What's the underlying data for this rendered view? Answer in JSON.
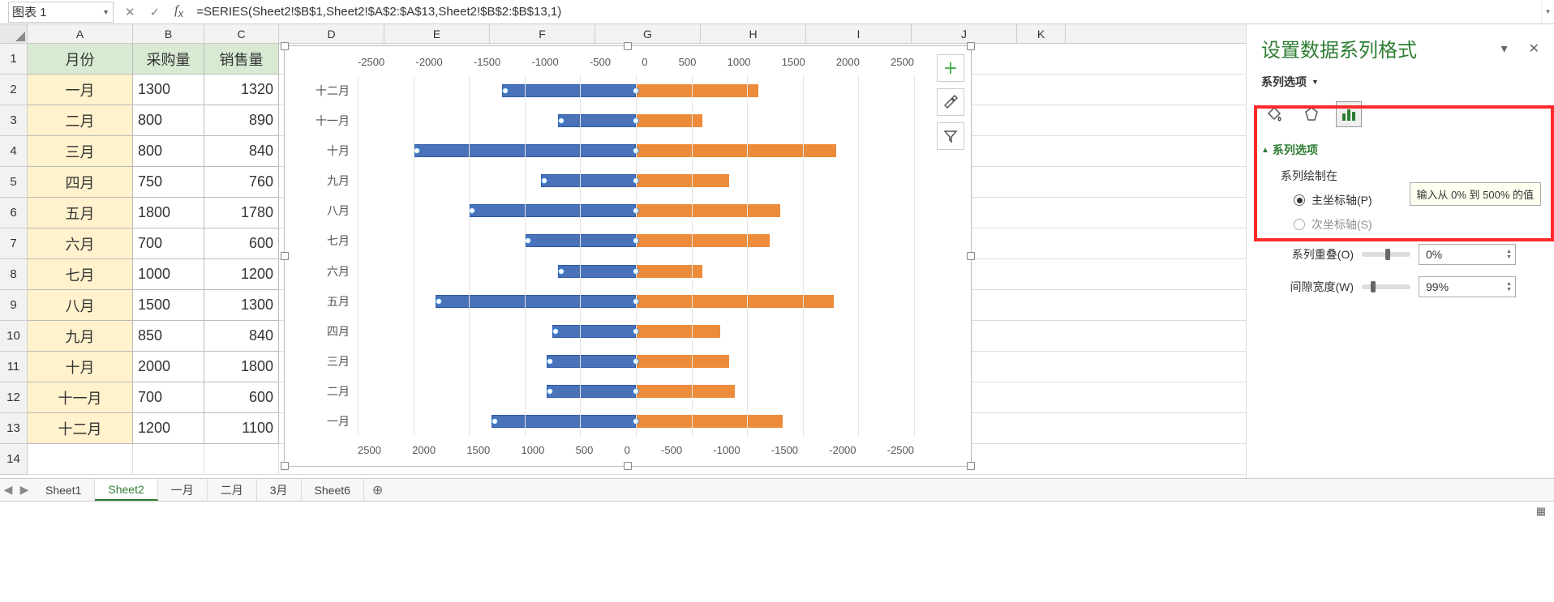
{
  "name_box": "图表 1",
  "formula": "=SERIES(Sheet2!$B$1,Sheet2!$A$2:$A$13,Sheet2!$B$2:$B$13,1)",
  "columns": [
    "A",
    "B",
    "C",
    "D",
    "E",
    "F",
    "G",
    "H",
    "I",
    "J",
    "K"
  ],
  "rows": [
    "1",
    "2",
    "3",
    "4",
    "5",
    "6",
    "7",
    "8",
    "9",
    "10",
    "11",
    "12",
    "13",
    "14"
  ],
  "data_headers": {
    "A": "月份",
    "B": "采购量",
    "C": "销售量"
  },
  "data_rows": [
    {
      "month": "一月",
      "buy": "1300",
      "sell": "1320"
    },
    {
      "month": "二月",
      "buy": "800",
      "sell": "890"
    },
    {
      "month": "三月",
      "buy": "800",
      "sell": "840"
    },
    {
      "month": "四月",
      "buy": "750",
      "sell": "760"
    },
    {
      "month": "五月",
      "buy": "1800",
      "sell": "1780"
    },
    {
      "month": "六月",
      "buy": "700",
      "sell": "600"
    },
    {
      "month": "七月",
      "buy": "1000",
      "sell": "1200"
    },
    {
      "month": "八月",
      "buy": "1500",
      "sell": "1300"
    },
    {
      "month": "九月",
      "buy": "850",
      "sell": "840"
    },
    {
      "month": "十月",
      "buy": "2000",
      "sell": "1800"
    },
    {
      "month": "十一月",
      "buy": "700",
      "sell": "600"
    },
    {
      "month": "十二月",
      "buy": "1200",
      "sell": "1100"
    }
  ],
  "chart_side_btns": {
    "plus": "＋",
    "brush": "🖌",
    "filter": "⧩"
  },
  "panel": {
    "title": "设置数据系列格式",
    "subtitle": "系列选项",
    "section": "系列选项",
    "plot_on": "系列绘制在",
    "primary_axis": "主坐标轴(P)",
    "secondary_axis": "次坐标轴(S)",
    "overlap_label": "系列重叠(O)",
    "overlap_value": "0%",
    "gap_label": "间隙宽度(W)",
    "gap_value": "99%",
    "tooltip": "输入从 0% 到 500% 的值"
  },
  "tabs": [
    "Sheet1",
    "Sheet2",
    "一月",
    "二月",
    "3月",
    "Sheet6"
  ],
  "active_tab": 1,
  "chart_data": {
    "type": "bar",
    "orientation": "horizontal",
    "categories": [
      "十二月",
      "十一月",
      "十月",
      "九月",
      "八月",
      "七月",
      "六月",
      "五月",
      "四月",
      "三月",
      "二月",
      "一月"
    ],
    "series": [
      {
        "name": "采购量",
        "color": "#4a72b8",
        "values": [
          -1200,
          -700,
          -2000,
          -850,
          -1500,
          -1000,
          -700,
          -1800,
          -750,
          -800,
          -800,
          -1300
        ]
      },
      {
        "name": "销售量",
        "color": "#ec8c3a",
        "values": [
          1100,
          600,
          1800,
          840,
          1300,
          1200,
          600,
          1780,
          760,
          840,
          890,
          1320
        ]
      }
    ],
    "axis_top": [
      "-2500",
      "-2000",
      "-1500",
      "-1000",
      "-500",
      "0",
      "500",
      "1000",
      "1500",
      "2000",
      "2500"
    ],
    "axis_bottom": [
      "2500",
      "2000",
      "1500",
      "1000",
      "500",
      "0",
      "-500",
      "-1000",
      "-1500",
      "-2000",
      "-2500"
    ],
    "xlim": [
      -2500,
      2500
    ]
  }
}
